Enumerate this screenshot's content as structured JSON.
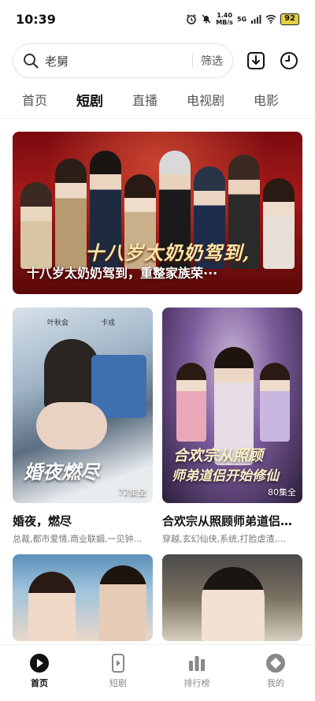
{
  "status_bar": {
    "time": "10:39",
    "net_speed_top": "1.40",
    "net_speed_unit": "MB/s",
    "signal": "5G",
    "battery": "92"
  },
  "search": {
    "query": "老舅",
    "filter_label": "筛选"
  },
  "tabs": [
    {
      "label": "首页",
      "active": false
    },
    {
      "label": "短剧",
      "active": true
    },
    {
      "label": "直播",
      "active": false
    },
    {
      "label": "电视剧",
      "active": false
    },
    {
      "label": "电影",
      "active": false
    }
  ],
  "banner": {
    "art_title": "十八岁太奶奶驾到,",
    "caption": "十八岁太奶奶驾到，重整家族荣···"
  },
  "cards": [
    {
      "title": "婚夜，燃尽",
      "tags": "总裁,都市爱情,商业联姻,一见钟…",
      "episodes": "72集全",
      "art_title": "婚夜燃尽",
      "credit_left": "叶秋会",
      "credit_right": "卡戎"
    },
    {
      "title": "合欢宗从照顾师弟道侣…",
      "tags": "穿越,玄幻仙侠,系统,打脸虐渣,…",
      "episodes": "80集全",
      "art_title_1": "合欢宗从照顾",
      "art_title_2": "师弟道侣开始修仙"
    }
  ],
  "bottom_nav": [
    {
      "label": "首页",
      "icon": "home-play-icon",
      "active": true
    },
    {
      "label": "短剧",
      "icon": "phone-play-icon",
      "active": false
    },
    {
      "label": "排行榜",
      "icon": "bar-chart-icon",
      "active": false
    },
    {
      "label": "我的",
      "icon": "profile-icon",
      "active": false
    }
  ],
  "colors": {
    "accent": "#111111",
    "banner_red": "#a51a18",
    "battery": "#e2d046"
  }
}
